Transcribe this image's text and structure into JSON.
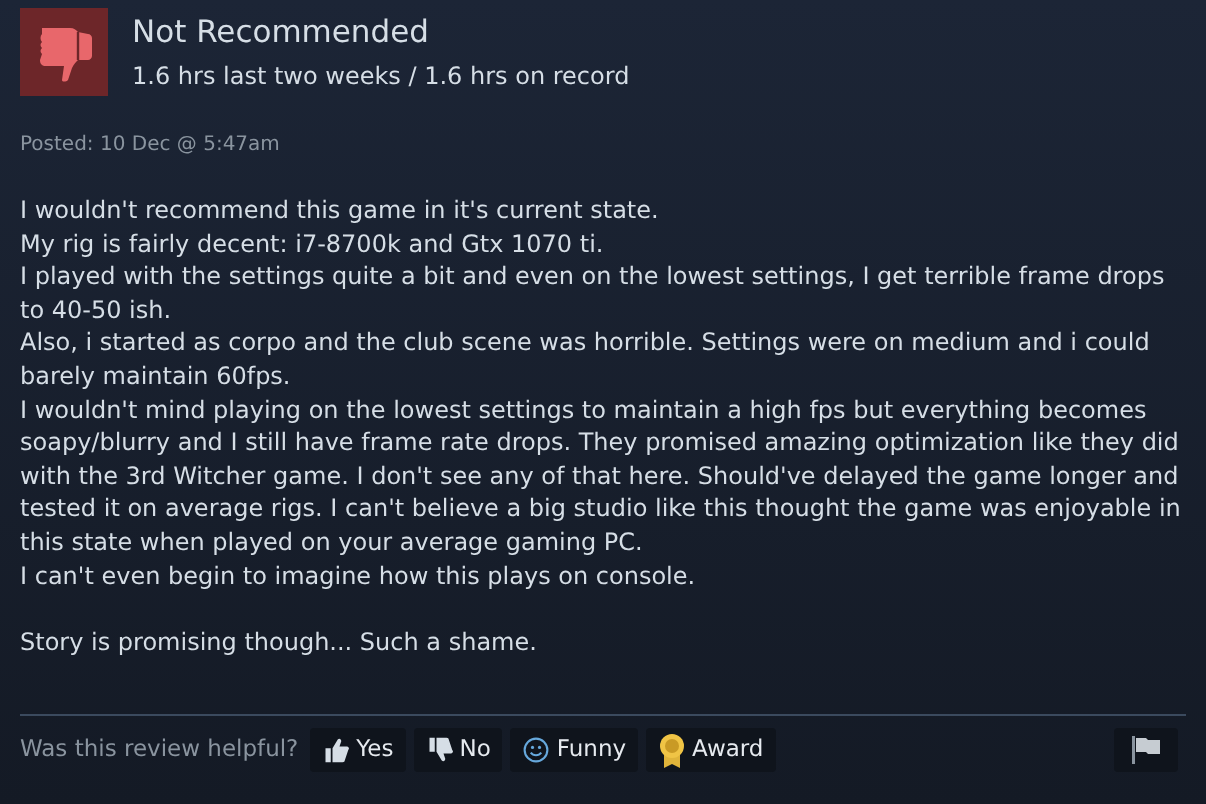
{
  "review": {
    "verdict": "Not Recommended",
    "hours": "1.6 hrs last two weeks / 1.6 hrs on record",
    "posted": "Posted: 10 Dec @ 5:47am",
    "paragraphs": [
      [
        "I wouldn't recommend this game in it's current state.",
        "My rig is fairly decent: i7-8700k and Gtx 1070 ti.",
        "I played with the settings quite a bit and even on the lowest settings, I get terrible frame drops to 40-50 ish.",
        "Also, i started as corpo and the club scene was horrible. Settings were on medium and i could barely maintain 60fps.",
        "I wouldn't mind playing on the lowest settings to maintain a high fps but everything becomes soapy/blurry and I still have frame rate drops. They promised amazing optimization like they did with the 3rd Witcher game. I don't see any of that here. Should've delayed the game longer and tested it on average rigs. I can't believe a big studio like this thought the game was enjoyable in this state when played on your average gaming PC.",
        "I can't even begin to imagine how this plays on console."
      ],
      [
        "Story is promising though... Such a shame."
      ]
    ]
  },
  "footer": {
    "question": "Was this review helpful?",
    "buttons": [
      {
        "kind": "yes",
        "label": "Yes"
      },
      {
        "kind": "no",
        "label": "No"
      },
      {
        "kind": "funny",
        "label": "Funny"
      },
      {
        "kind": "award",
        "label": "Award"
      }
    ]
  }
}
